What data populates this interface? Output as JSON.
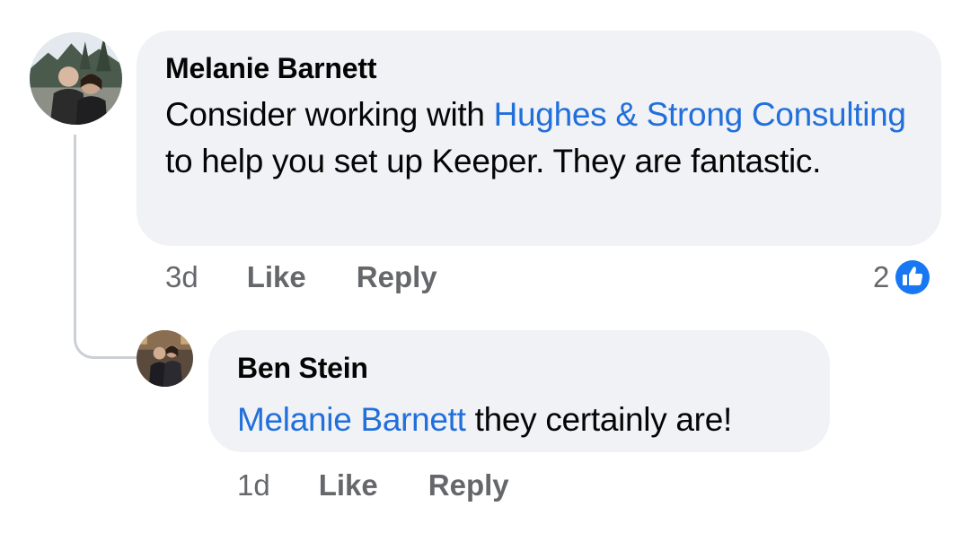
{
  "comments": [
    {
      "author": "Melanie Barnett",
      "text_before": "Consider working with ",
      "mention": "Hughes & Strong Consulting",
      "text_after": " to help you set up Keeper. They are fantastic.",
      "time": "3d",
      "like_label": "Like",
      "reply_label": "Reply",
      "reaction_count": "2",
      "reaction_icon": "like-thumbs-up-icon"
    },
    {
      "author": "Ben Stein",
      "mention": "Melanie Barnett",
      "text_after": " they certainly are!",
      "time": "1d",
      "like_label": "Like",
      "reply_label": "Reply"
    }
  ],
  "colors": {
    "bubble": "#f0f2f5",
    "mention": "#216fdb",
    "meta": "#65676b",
    "text": "#050505",
    "like_badge": "#1877f2"
  }
}
